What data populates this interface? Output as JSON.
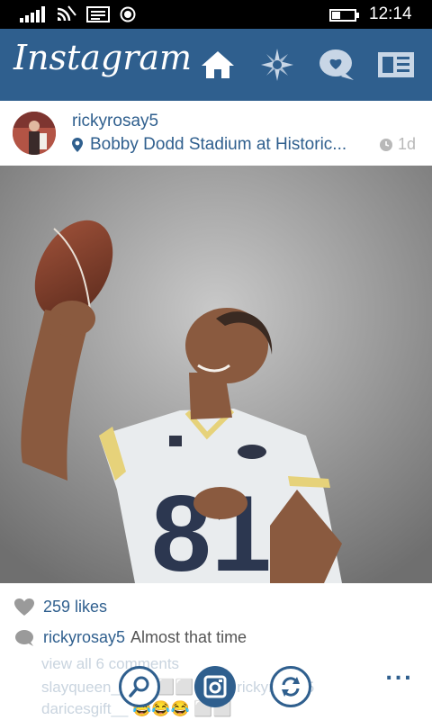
{
  "status_bar": {
    "time": "12:14",
    "icons": [
      "signal-icon",
      "wifi-icon",
      "message-icon",
      "record-icon",
      "battery-icon"
    ]
  },
  "app_bar": {
    "logo": "Instagram",
    "nav": [
      "home-icon",
      "explore-icon",
      "inbox-icon",
      "news-icon"
    ]
  },
  "post": {
    "username": "rickyrosay5",
    "location": "Bobby Dodd Stadium at Historic...",
    "timestamp": "1d",
    "likes": "259 likes",
    "caption_user": "rickyrosay5",
    "caption_text": "Almost that time",
    "view_all": "view all 6 comments",
    "comment1": "slayqueen__ 🙌 ⬜⬜ ✨ @rickyrosay5",
    "comment2": "daricesgift__ 😂😂😂 ⬜⬜"
  },
  "bottom_bar": {
    "buttons": [
      "search-icon",
      "camera-icon",
      "refresh-icon"
    ],
    "more": "..."
  },
  "colors": {
    "brand": "#2f5f8e",
    "status_bar": "#000000",
    "timestamp": "#b8b8b8"
  }
}
